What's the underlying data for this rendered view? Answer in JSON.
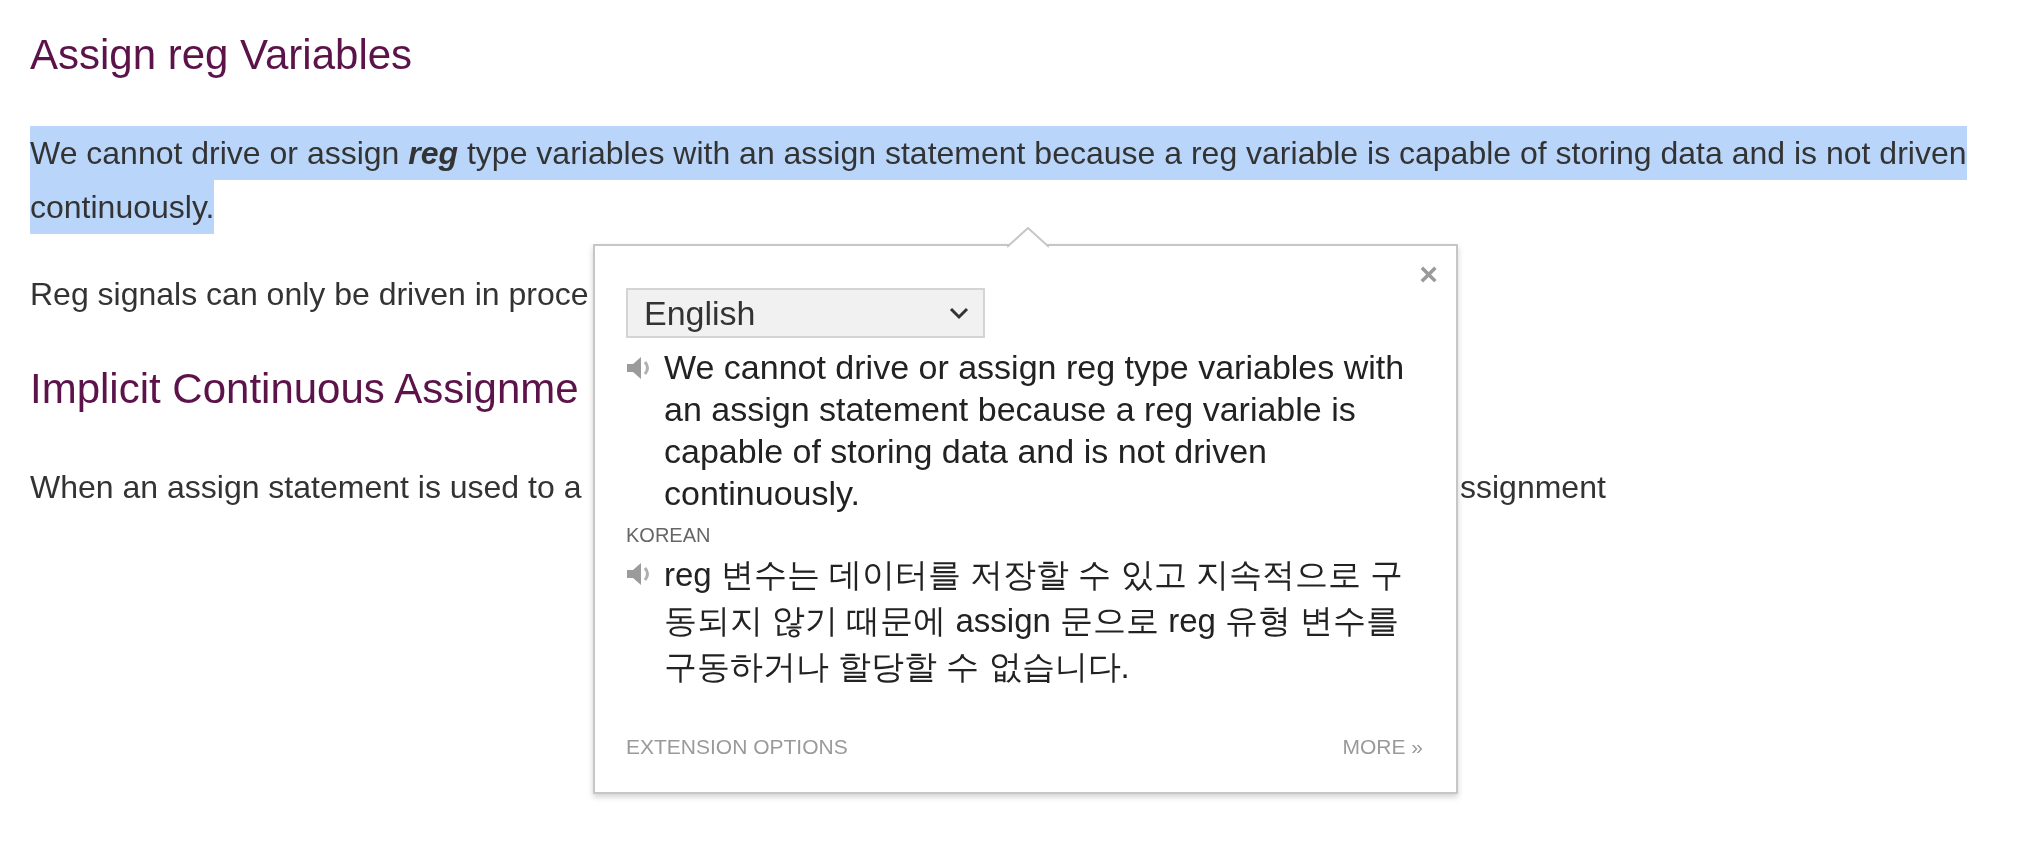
{
  "article": {
    "blocks": [
      {
        "kind": "heading",
        "text": "Assign reg Variables"
      },
      {
        "kind": "paragraph",
        "highlighted": true,
        "parts": [
          "We cannot drive or assign **reg** type variables with an assign statement because a reg variable is capable of storing data and is not driven continuously."
        ]
      },
      {
        "kind": "paragraph",
        "highlighted": false,
        "parts": [
          "Reg signals can only be driven in proce"
        ]
      },
      {
        "kind": "heading",
        "text": "Implicit Continuous Assignme"
      },
      {
        "kind": "paragraph",
        "highlighted": false,
        "parts": [
          "When an assign statement is used to a",
          "ssignment"
        ]
      }
    ]
  },
  "translation_popup": {
    "close_label": "×",
    "language_select": {
      "value": "English"
    },
    "source_text": "We cannot drive or assign reg type variables with an assign statement because a reg variable is capable of storing data and is not driven continuously.",
    "target_language": "KOREAN",
    "target_text": "reg 변수는 데이터를 저장할 수 있고 지속적으로 구동되지 않기 때문에 assign 문으로 reg 유형 변수를 구동하거나 할당할 수 없습니다.",
    "footer_links": [
      "EXTENSION OPTIONS",
      "MORE »"
    ]
  }
}
